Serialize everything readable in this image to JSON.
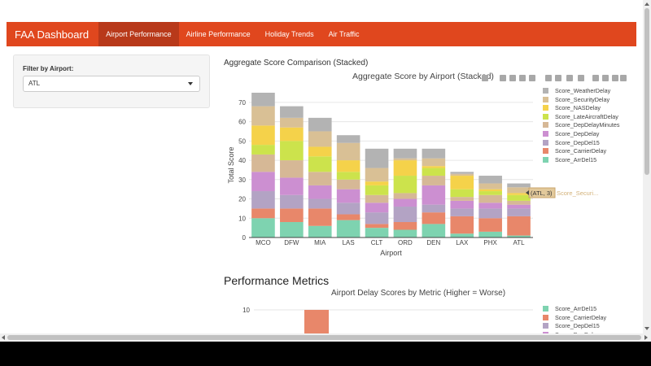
{
  "navbar": {
    "brand": "FAA Dashboard",
    "tabs": [
      "Airport Performance",
      "Airline Performance",
      "Holiday Trends",
      "Air Traffic"
    ],
    "active_tab": "Airport Performance",
    "color": "#e0471e"
  },
  "filter": {
    "label": "Filter by Airport:",
    "selected": "ATL"
  },
  "section1": {
    "title": "Aggregate Score Comparison (Stacked)"
  },
  "section2": {
    "heading": "Performance Metrics"
  },
  "hover_label": {
    "text": "(ATL, 3)",
    "series_hint": "Score_Securi..."
  },
  "modebar_icons": [
    "camera-icon",
    "zoom-icon",
    "pan-icon",
    "box-select-icon",
    "lasso-icon",
    "zoom-in-icon",
    "zoom-out-icon",
    "autoscale-icon",
    "reset-axes-icon",
    "spike-lines-icon",
    "compare-hover-icon",
    "closest-hover-icon",
    "plotly-logo-icon"
  ],
  "chart_data": [
    {
      "type": "bar",
      "stacked": true,
      "title": "Aggregate Score by Airport (Stacked)",
      "xlabel": "Airport",
      "ylabel": "Total Score",
      "ylim": [
        0,
        75
      ],
      "yticks": [
        0,
        10,
        20,
        30,
        40,
        50,
        60,
        70
      ],
      "grid": true,
      "legend_position": "right",
      "categories": [
        "MCO",
        "DFW",
        "MIA",
        "LAS",
        "CLT",
        "ORD",
        "DEN",
        "LAX",
        "PHX",
        "ATL"
      ],
      "series": [
        {
          "name": "Score_ArrDel15",
          "color": "#7ed3b0",
          "values": [
            10,
            8,
            6,
            9,
            5,
            4,
            7,
            2,
            3,
            1
          ]
        },
        {
          "name": "Score_CarrierDelay",
          "color": "#e8876a",
          "values": [
            5,
            7,
            9,
            3,
            2,
            4,
            6,
            9,
            7,
            10
          ]
        },
        {
          "name": "Score_DepDel15",
          "color": "#b3a3c4",
          "values": [
            9,
            7,
            5,
            6,
            6,
            8,
            4,
            4,
            5,
            4
          ]
        },
        {
          "name": "Score_DepDelay",
          "color": "#cc8fd1",
          "values": [
            10,
            9,
            7,
            7,
            5,
            4,
            10,
            4,
            3,
            2
          ]
        },
        {
          "name": "Score_DepDelayMinutes",
          "color": "#d6b896",
          "values": [
            9,
            9,
            7,
            5,
            4,
            3,
            5,
            2,
            4,
            2
          ]
        },
        {
          "name": "Score_LateAircraftDelay",
          "color": "#cce34c",
          "values": [
            5,
            10,
            8,
            4,
            5,
            9,
            4,
            4,
            2,
            3
          ]
        },
        {
          "name": "Score_NASDelay",
          "color": "#f5d24a",
          "values": [
            10,
            7,
            5,
            6,
            2,
            8,
            1,
            7,
            1,
            1
          ]
        },
        {
          "name": "Score_SecurityDelay",
          "color": "#d9c095",
          "values": [
            10,
            5,
            8,
            9,
            7,
            1,
            4,
            1,
            3,
            3
          ]
        },
        {
          "name": "Score_WeatherDelay",
          "color": "#b3b3b3",
          "values": [
            7,
            6,
            7,
            4,
            10,
            5,
            5,
            1,
            4,
            2
          ]
        }
      ]
    },
    {
      "type": "bar",
      "title": "Airport Delay Scores by Metric (Higher = Worse)",
      "yticks_visible": [
        10
      ],
      "legend_position": "right",
      "visible_series": [
        {
          "name": "Score_ArrDel15",
          "color": "#7ed3b0"
        },
        {
          "name": "Score_CarrierDelay",
          "color": "#e8876a",
          "visible_value": 10
        },
        {
          "name": "Score_DepDel15",
          "color": "#b3a3c4"
        },
        {
          "name": "Score_DepDelay",
          "color": "#cc8fd1"
        }
      ]
    }
  ]
}
